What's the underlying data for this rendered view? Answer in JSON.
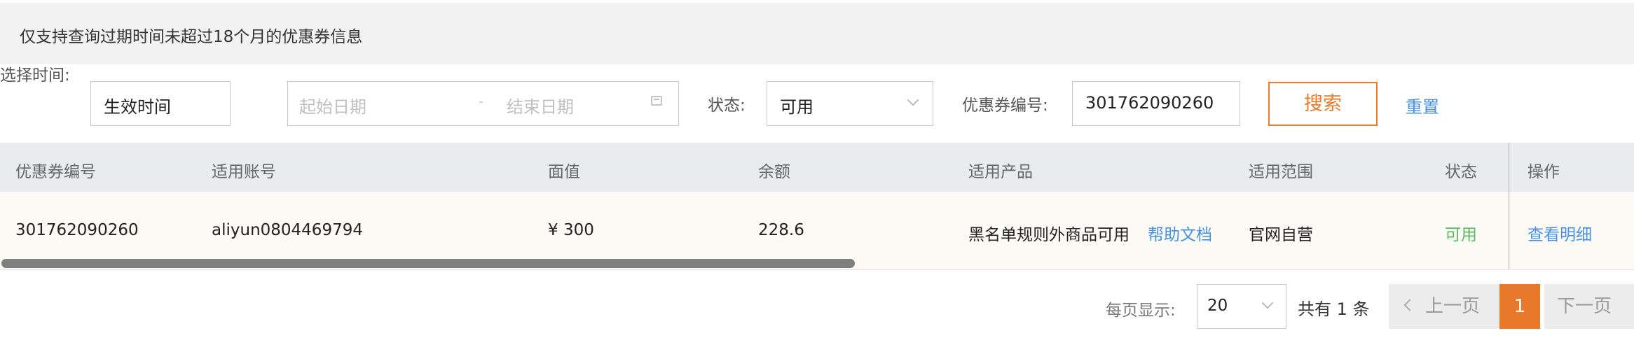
{
  "notice": {
    "text": "仅支持查询过期时间未超过18个月的优惠券信息"
  },
  "filters": {
    "time_label": "选择时间:",
    "time_type_value": "生效时间",
    "start_placeholder": "起始日期",
    "separator": "-",
    "end_placeholder": "结束日期",
    "status_label": "状态:",
    "status_value": "可用",
    "coupon_label": "优惠券编号:",
    "coupon_value": "301762090260",
    "search_label": "搜索",
    "reset_label": "重置"
  },
  "table": {
    "columns": [
      "优惠券编号",
      "适用账号",
      "面值",
      "余额",
      "适用产品",
      "适用范围",
      "状态",
      "操作"
    ],
    "rows": [
      {
        "coupon_no": "301762090260",
        "account": "aliyun0804469794",
        "face_value": "¥ 300",
        "balance": "228.6",
        "product": "黑名单规则外商品可用",
        "help_link": "帮助文档",
        "scope": "官网自营",
        "status": "可用",
        "action": "查看明细"
      }
    ]
  },
  "pagination": {
    "per_page_label": "每页显示:",
    "per_page_value": "20",
    "total_text": "共有 1 条",
    "prev_label": "上一页",
    "current_page": "1",
    "next_label": "下一页"
  },
  "colors": {
    "accent": "#e8782a",
    "link": "#4a90e2",
    "status_available": "#5cb85c",
    "header_bg": "#e9ebef"
  }
}
